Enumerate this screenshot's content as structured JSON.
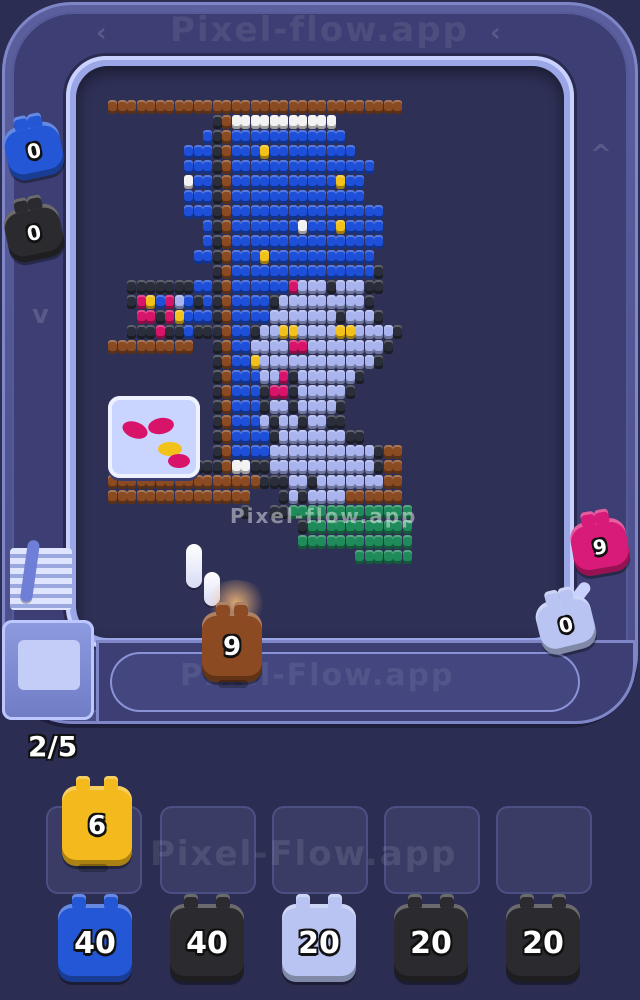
{
  "watermark": "Pixel-flow.app",
  "board_watermark": "Pixel-flow.app",
  "rail_watermark": "Pixel-Flow.app",
  "slot_watermark": "Pixel-Flow.app",
  "progress_text": "2/5",
  "palette": {
    "B": "#1d4fd8",
    "D": "#2a2d3a",
    "O": "#8a4a22",
    "W": "#f2f2f2",
    "L": "#a9b4ee",
    "M": "#d8146a",
    "Y": "#f3c21a",
    "G": "#1f8a5a",
    "K": "#111111"
  },
  "conveyor_shooters": [
    {
      "name": "blue-shooter-conveyor",
      "count": "0",
      "color": "#2457d6"
    },
    {
      "name": "black-shooter-conveyor",
      "count": "0",
      "color": "#2b2b2f"
    },
    {
      "name": "magenta-shooter-conveyor",
      "count": "9",
      "color": "#d81a78"
    },
    {
      "name": "lavender-shooter-conveyor",
      "count": "0",
      "color": "#b9c4f2"
    },
    {
      "name": "brown-shooter-active",
      "count": "9",
      "color": "#8b4a22"
    }
  ],
  "tray_shooter": {
    "count": "6",
    "color": "#f4b91c"
  },
  "queue": [
    {
      "count": "40",
      "color": "#2457d6"
    },
    {
      "count": "40",
      "color": "#2b2b2f"
    },
    {
      "count": "20",
      "color": "#b9c4f2"
    },
    {
      "count": "20",
      "color": "#2b2b2f"
    },
    {
      "count": "20",
      "color": "#2b2b2f"
    }
  ]
}
